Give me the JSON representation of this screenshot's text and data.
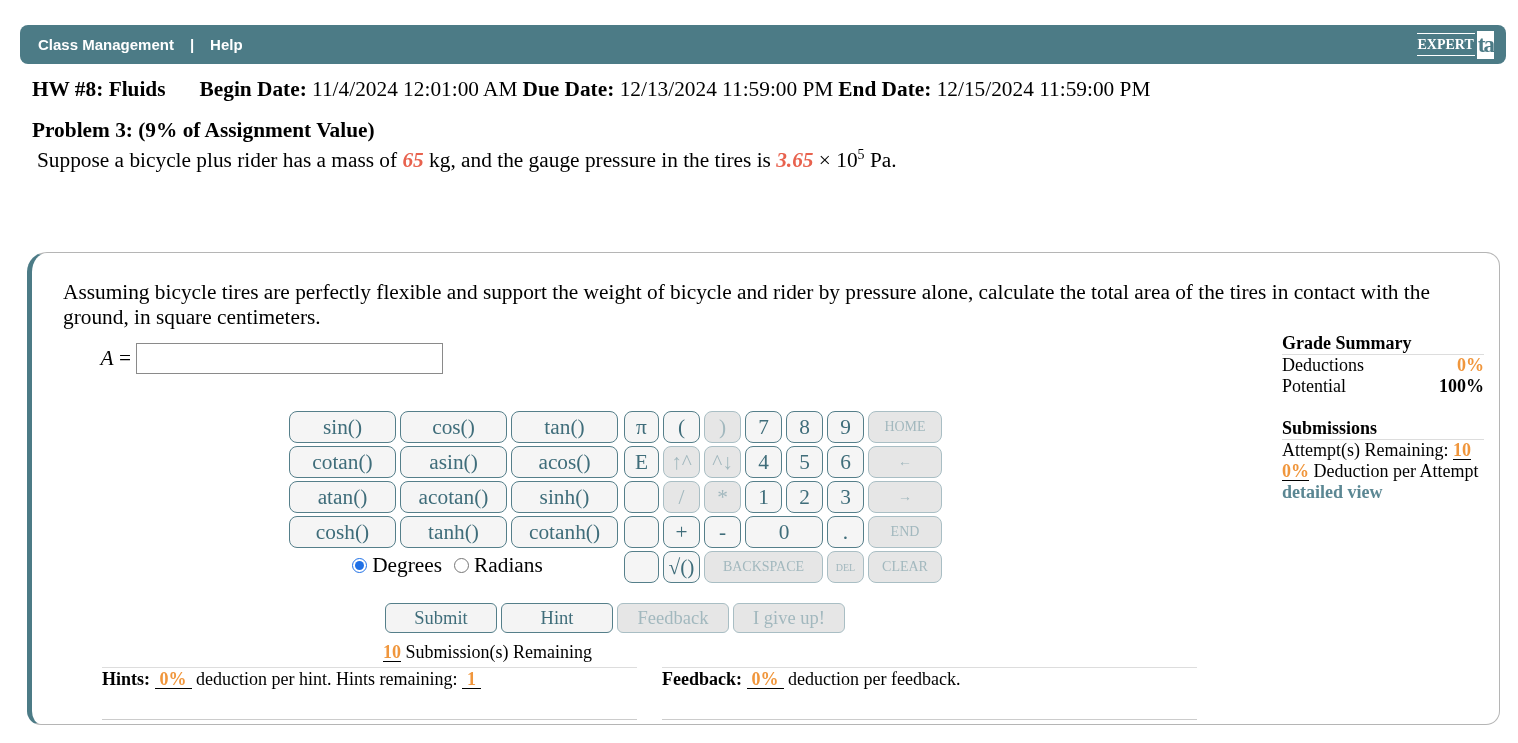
{
  "nav": {
    "links": [
      "Class Management",
      "Help"
    ],
    "separator": "|",
    "logo": {
      "word": "EXPERT",
      "mark": "ta"
    }
  },
  "assignment": {
    "title": "HW #8: Fluids",
    "dates": [
      {
        "label": "Begin Date:",
        "value": "11/4/2024 12:01:00 AM"
      },
      {
        "label": "Due Date:",
        "value": "12/13/2024 11:59:00 PM"
      },
      {
        "label": "End Date:",
        "value": "12/15/2024 11:59:00 PM"
      }
    ]
  },
  "problem": {
    "heading": "Problem 3: (9% of Assignment Value)",
    "statement": [
      {
        "kind": "text",
        "text": "Suppose a bicycle plus rider has a mass of "
      },
      {
        "kind": "given",
        "text": "65"
      },
      {
        "kind": "text",
        "text": " kg, and the gauge pressure in the tires is "
      },
      {
        "kind": "given",
        "text": "3.65"
      },
      {
        "kind": "text",
        "text": " × 10"
      },
      {
        "kind": "sup",
        "text": "5"
      },
      {
        "kind": "text",
        "text": " Pa."
      }
    ]
  },
  "question": {
    "text": "Assuming bicycle tires are perfectly flexible and support the weight of bicycle and rider by pressure alone, calculate the total area of the tires in contact with the ground, in square centimeters.",
    "answer_label": "*A* ="
  },
  "keypad": {
    "functions": [
      "sin()",
      "cos()",
      "tan()",
      "cotan()",
      "asin()",
      "acos()",
      "atan()",
      "acotan()",
      "sinh()",
      "cosh()",
      "tanh()",
      "cotanh()"
    ],
    "keys": [
      {
        "label": "π",
        "kind": "key",
        "disabled": false
      },
      {
        "label": "(",
        "kind": "key",
        "disabled": false
      },
      {
        "label": ")",
        "kind": "key",
        "disabled": true
      },
      {
        "label": "7",
        "kind": "key",
        "disabled": false
      },
      {
        "label": "8",
        "kind": "key",
        "disabled": false
      },
      {
        "label": "9",
        "kind": "key",
        "disabled": false
      },
      {
        "label": "HOME",
        "kind": "edit",
        "disabled": true
      },
      {
        "label": "E",
        "kind": "key",
        "disabled": false
      },
      {
        "label": "↑^",
        "kind": "key",
        "disabled": true
      },
      {
        "label": "^↓",
        "kind": "key",
        "disabled": true
      },
      {
        "label": "4",
        "kind": "key",
        "disabled": false
      },
      {
        "label": "5",
        "kind": "key",
        "disabled": false
      },
      {
        "label": "6",
        "kind": "key",
        "disabled": false
      },
      {
        "label": "←",
        "kind": "edit",
        "disabled": true
      },
      {
        "kind": "key",
        "disabled": false
      },
      {
        "label": "/",
        "kind": "key",
        "disabled": true
      },
      {
        "label": "*",
        "kind": "key",
        "disabled": true
      },
      {
        "label": "1",
        "kind": "key",
        "disabled": false
      },
      {
        "label": "2",
        "kind": "key",
        "disabled": false
      },
      {
        "label": "3",
        "kind": "key",
        "disabled": false
      },
      {
        "label": "→",
        "kind": "edit",
        "disabled": true
      },
      {
        "kind": "key",
        "disabled": false
      },
      {
        "label": "+",
        "kind": "key",
        "disabled": false
      },
      {
        "label": "-",
        "kind": "key",
        "disabled": false
      },
      {
        "label": "0",
        "kind": "double",
        "disabled": false
      },
      {
        "label": ".",
        "kind": "key",
        "disabled": false
      },
      {
        "label": "END",
        "kind": "edit",
        "disabled": true
      },
      {
        "kind": "key",
        "disabled": false
      },
      {
        "label": "√()",
        "kind": "key",
        "disabled": false
      },
      {
        "label": "BACKSPACE",
        "kind": "triple",
        "disabled": true
      },
      {
        "label": "DEL",
        "kind": "small",
        "disabled": true
      },
      {
        "label": "CLEAR",
        "kind": "edit",
        "disabled": true
      }
    ]
  },
  "angle_units": [
    {
      "label": "Degrees",
      "selected": true
    },
    {
      "label": "Radians",
      "selected": false
    }
  ],
  "actions": [
    {
      "label": "Submit",
      "disabled": false
    },
    {
      "label": "Hint",
      "disabled": false
    },
    {
      "label": "Feedback",
      "disabled": true
    },
    {
      "label": "I give up!",
      "disabled": true
    }
  ],
  "submissions_remaining": {
    "count": "10",
    "text": "Submission(s) Remaining"
  },
  "hints": {
    "label": "Hints:",
    "deduction": "0%",
    "text": "deduction per hint. Hints remaining:",
    "remaining": "1"
  },
  "feedback": {
    "label": "Feedback:",
    "deduction": "0%",
    "text": "deduction per feedback."
  },
  "grade_summary": {
    "title": "Grade Summary",
    "rows": [
      {
        "label": "Deductions",
        "value": "0%",
        "kind": "deduction"
      },
      {
        "label": "Potential",
        "value": "100%",
        "kind": "total"
      }
    ]
  },
  "submissions": {
    "title": "Submissions",
    "attempts_label": "Attempt(s) Remaining:",
    "attempts": "10",
    "deduction": "0%",
    "deduction_label": "Deduction per Attempt",
    "link": "detailed view"
  }
}
